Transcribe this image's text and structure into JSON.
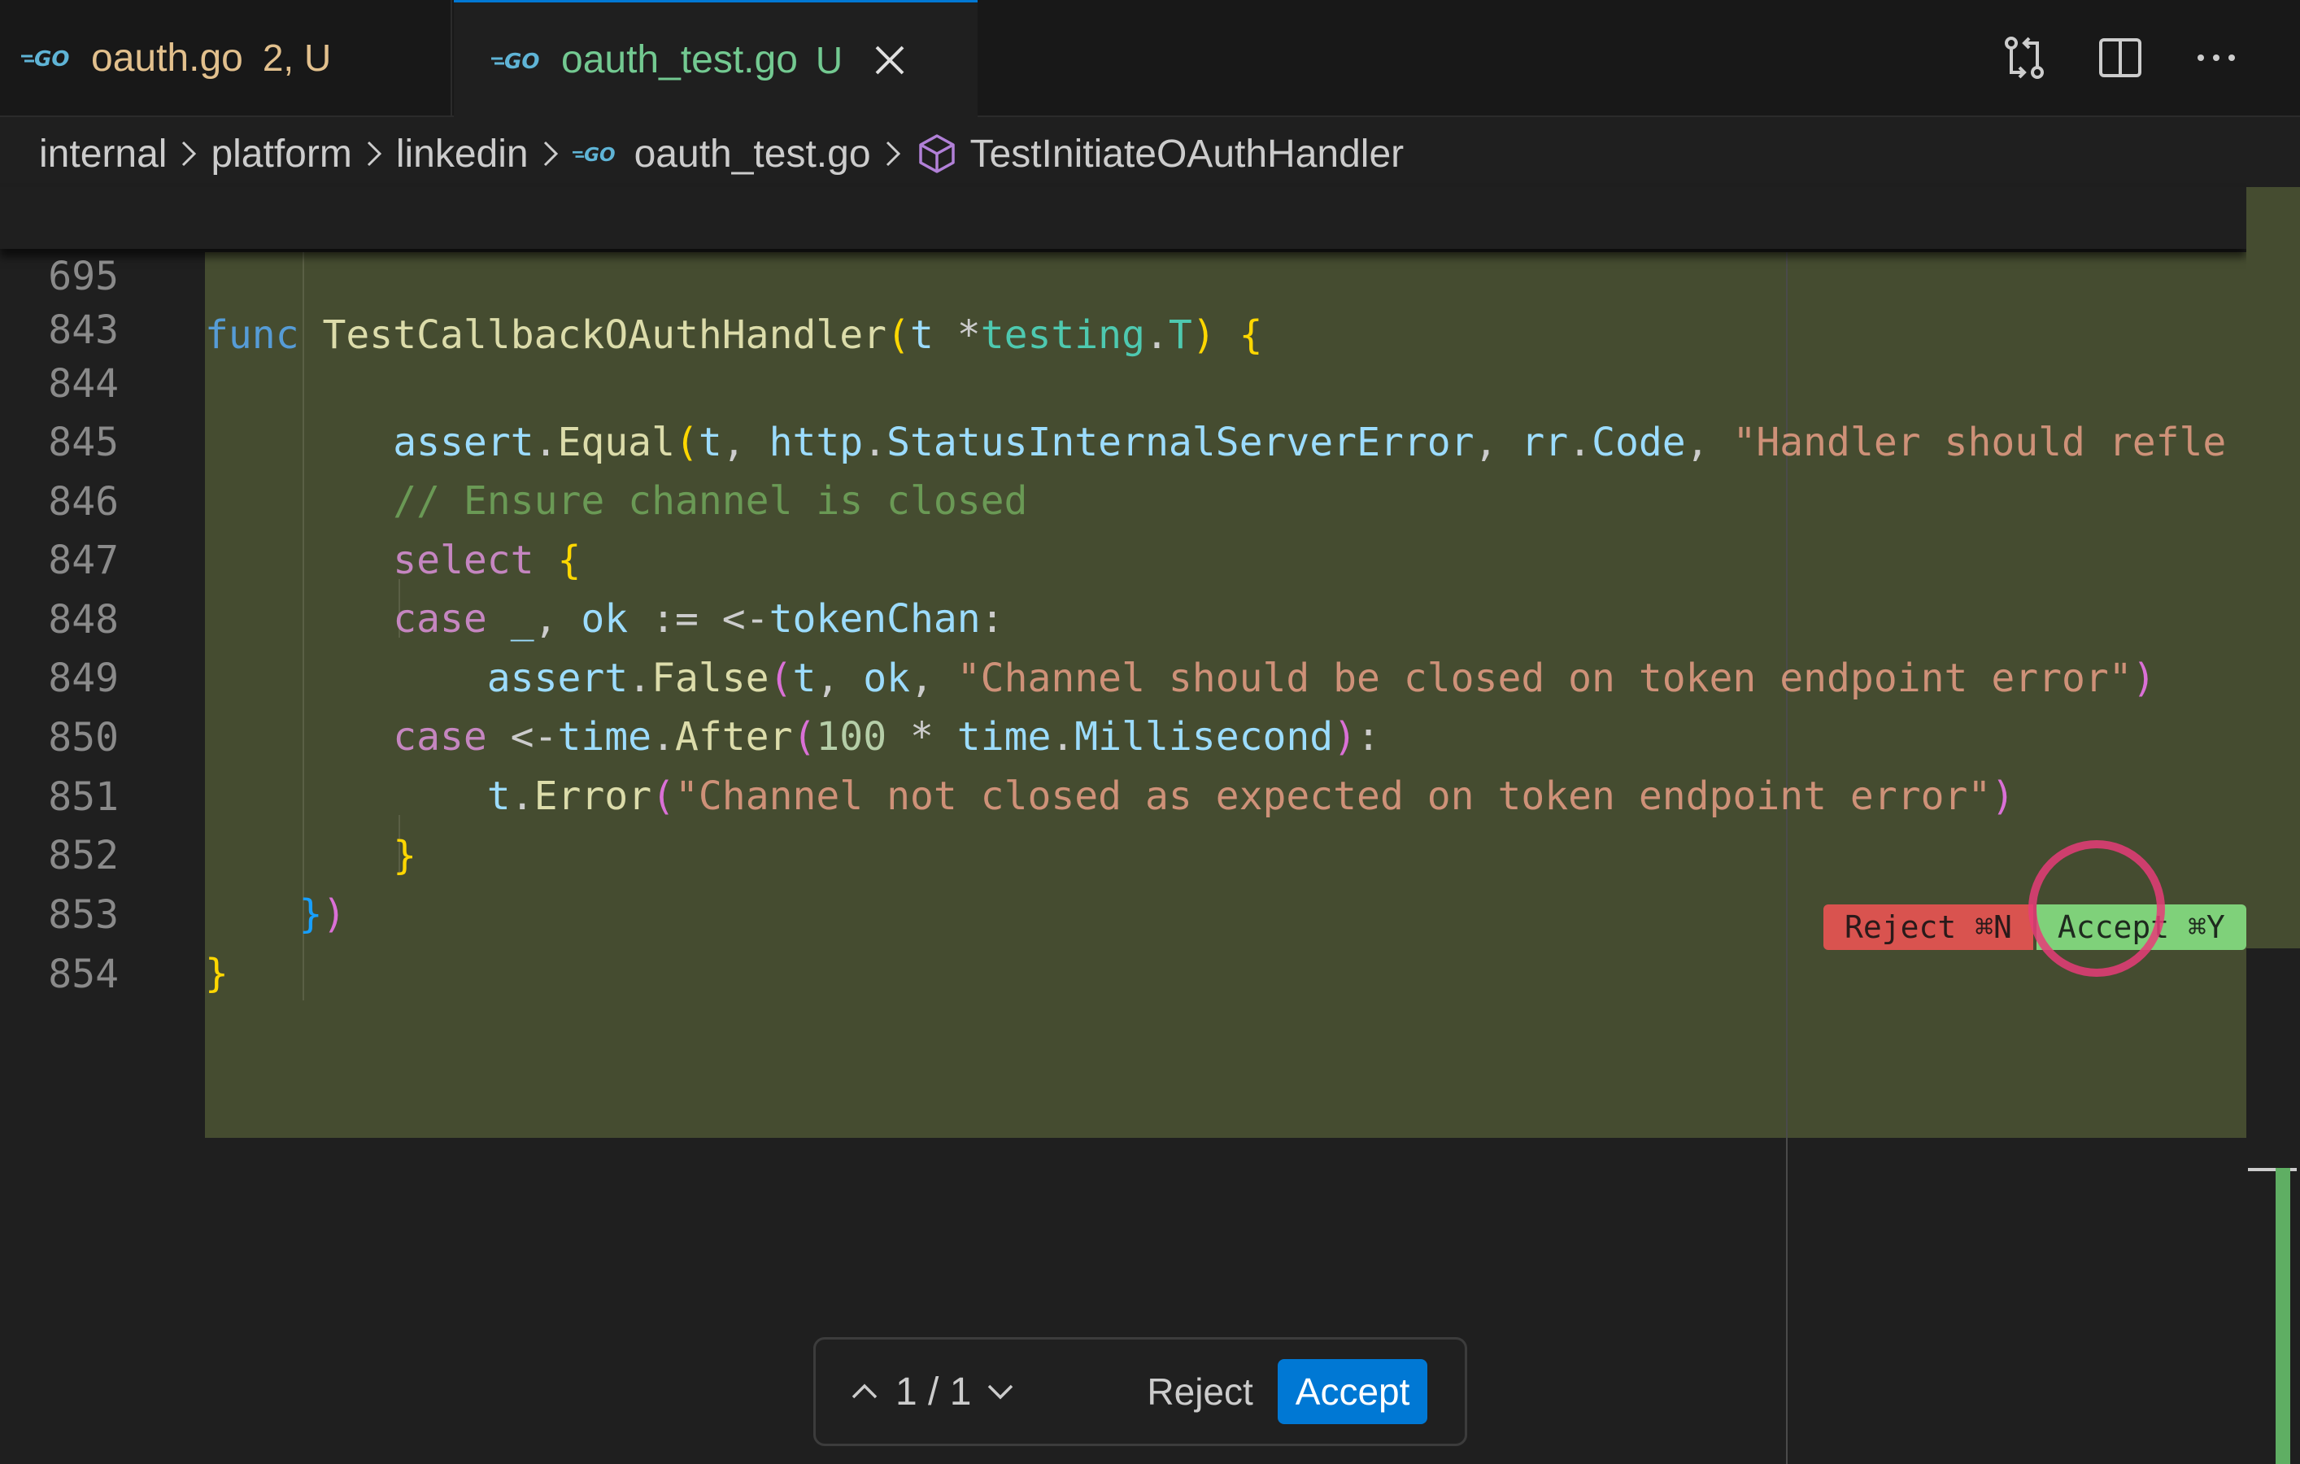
{
  "tabs": [
    {
      "name": "oauth.go",
      "status": "2, U",
      "active": false
    },
    {
      "name": "oauth_test.go",
      "status": "U",
      "active": true
    }
  ],
  "icons": {
    "go_logo": "go-logo-icon",
    "close": "close-icon",
    "compare": "compare-changes-icon",
    "split": "split-editor-icon",
    "more": "more-actions-icon",
    "chevron_right": "chevron-right-icon",
    "symbol": "symbol-method-icon",
    "chevron_up": "chevron-up-icon",
    "chevron_down": "chevron-down-icon"
  },
  "breadcrumbs": {
    "items": [
      "internal",
      "platform",
      "linkedin",
      "oauth_test.go",
      "TestInitiateOAuthHandler"
    ]
  },
  "sticky": {
    "line_number": "695",
    "code": "func TestCallbackOAuthHandler(t *testing.T) {"
  },
  "code_lines": [
    {
      "n": "843",
      "text": ""
    },
    {
      "n": "844",
      "text": "        assert.Equal(t, http.StatusInternalServerError, rr.Code, \"Handler should refle"
    },
    {
      "n": "845",
      "text": "        // Ensure channel is closed"
    },
    {
      "n": "846",
      "text": "        select {"
    },
    {
      "n": "847",
      "text": "        case _, ok := <-tokenChan:"
    },
    {
      "n": "848",
      "text": "            assert.False(t, ok, \"Channel should be closed on token endpoint error\")"
    },
    {
      "n": "849",
      "text": "        case <-time.After(100 * time.Millisecond):"
    },
    {
      "n": "850",
      "text": "            t.Error(\"Channel not closed as expected on token endpoint error\")"
    },
    {
      "n": "851",
      "text": "        }"
    },
    {
      "n": "852",
      "text": "    })"
    },
    {
      "n": "853",
      "text": "}"
    },
    {
      "n": "854",
      "text": ""
    }
  ],
  "inline_actions": {
    "reject": "Reject ⌘N",
    "accept": "Accept ⌘Y"
  },
  "diff_toolbar": {
    "counter": "1 / 1",
    "reject": "Reject",
    "accept": "Accept"
  },
  "colors": {
    "accent": "#0078d4",
    "diff_bg": "#454c30",
    "modified_tab": "#e2c08d",
    "untracked_tab": "#73c991",
    "reject": "#d9534f",
    "accept": "#7fd17a"
  }
}
